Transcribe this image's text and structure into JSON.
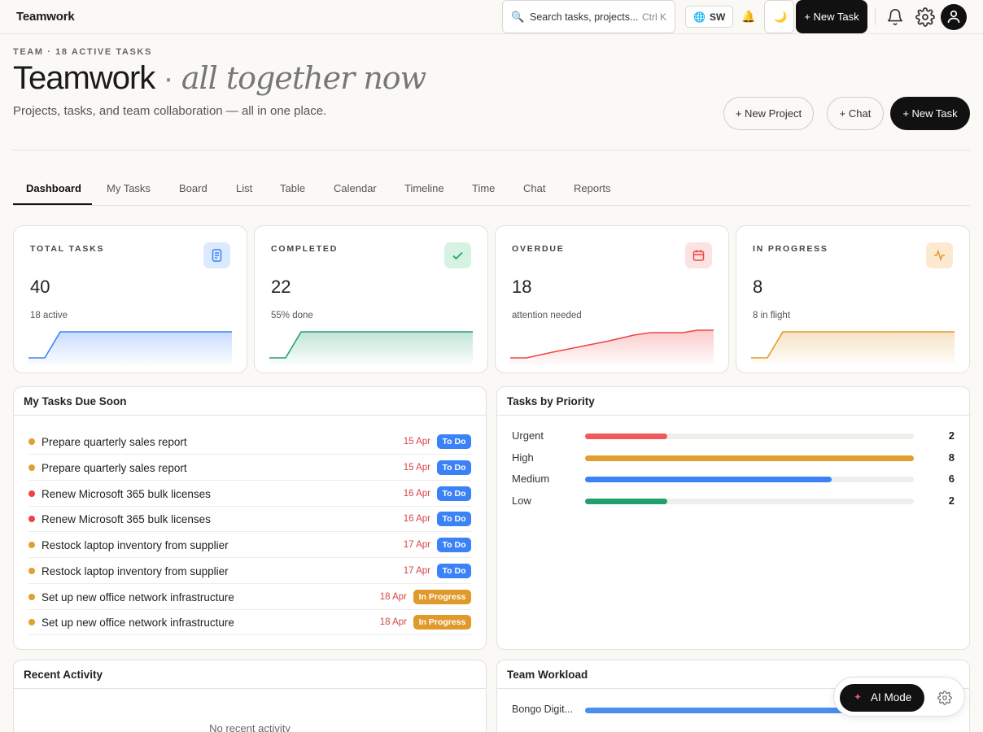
{
  "app": {
    "brand": "Teamwork"
  },
  "topbar": {
    "search_placeholder": "Search tasks, projects...",
    "search_shortcut": "Ctrl K",
    "language": "SW",
    "new_task_label": "+ New Task"
  },
  "header": {
    "eyebrow": "TEAM · 18 ACTIVE TASKS",
    "title": "Teamwork",
    "separator": "·",
    "subtitle": "all together now",
    "tagline": "Projects, tasks, and team collaboration — all in one place.",
    "new_project_label": "+ New Project",
    "chat_label": "+ Chat",
    "new_task_label": "+ New Task"
  },
  "tabs": [
    "Dashboard",
    "My Tasks",
    "Board",
    "List",
    "Table",
    "Calendar",
    "Timeline",
    "Time",
    "Chat",
    "Reports"
  ],
  "stats": [
    {
      "label": "TOTAL TASKS",
      "value": "40",
      "sub": "18 active",
      "color": "#3b82f6",
      "icon": "document-icon"
    },
    {
      "label": "COMPLETED",
      "value": "22",
      "sub": "55% done",
      "color": "#22a06b",
      "icon": "check-icon"
    },
    {
      "label": "OVERDUE",
      "value": "18",
      "sub": "attention needed",
      "color": "#ef4444",
      "icon": "calendar-icon"
    },
    {
      "label": "IN PROGRESS",
      "value": "8",
      "sub": "8 in flight",
      "color": "#e09a2b",
      "icon": "activity-icon"
    }
  ],
  "due_soon": {
    "title": "My Tasks Due Soon",
    "tasks": [
      {
        "name": "Prepare quarterly sales report",
        "date": "15 Apr",
        "status": "To Do",
        "priority_color": "#e0a030"
      },
      {
        "name": "Prepare quarterly sales report",
        "date": "15 Apr",
        "status": "To Do",
        "priority_color": "#e0a030"
      },
      {
        "name": "Renew Microsoft 365 bulk licenses",
        "date": "16 Apr",
        "status": "To Do",
        "priority_color": "#ef4444"
      },
      {
        "name": "Renew Microsoft 365 bulk licenses",
        "date": "16 Apr",
        "status": "To Do",
        "priority_color": "#ef4444"
      },
      {
        "name": "Restock laptop inventory from supplier",
        "date": "17 Apr",
        "status": "To Do",
        "priority_color": "#e0a030"
      },
      {
        "name": "Restock laptop inventory from supplier",
        "date": "17 Apr",
        "status": "To Do",
        "priority_color": "#e0a030"
      },
      {
        "name": "Set up new office network infrastructure",
        "date": "18 Apr",
        "status": "In Progress",
        "priority_color": "#e0a030"
      },
      {
        "name": "Set up new office network infrastructure",
        "date": "18 Apr",
        "status": "In Progress",
        "priority_color": "#e0a030"
      }
    ]
  },
  "priority": {
    "title": "Tasks by Priority",
    "max": 8,
    "rows": [
      {
        "label": "Urgent",
        "value": 2,
        "color": "#f05a5a"
      },
      {
        "label": "High",
        "value": 8,
        "color": "#e0a030"
      },
      {
        "label": "Medium",
        "value": 6,
        "color": "#3b82f6"
      },
      {
        "label": "Low",
        "value": 2,
        "color": "#22a06b"
      }
    ]
  },
  "activity": {
    "title": "Recent Activity",
    "empty": "No recent activity"
  },
  "workload": {
    "title": "Team Workload",
    "rows": [
      {
        "label": "Bongo Digit..."
      }
    ]
  },
  "ai": {
    "label": "AI Mode"
  },
  "colors": {
    "todo": "#3b82f6",
    "in_progress": "#e09a2b",
    "date": "#d64545"
  }
}
